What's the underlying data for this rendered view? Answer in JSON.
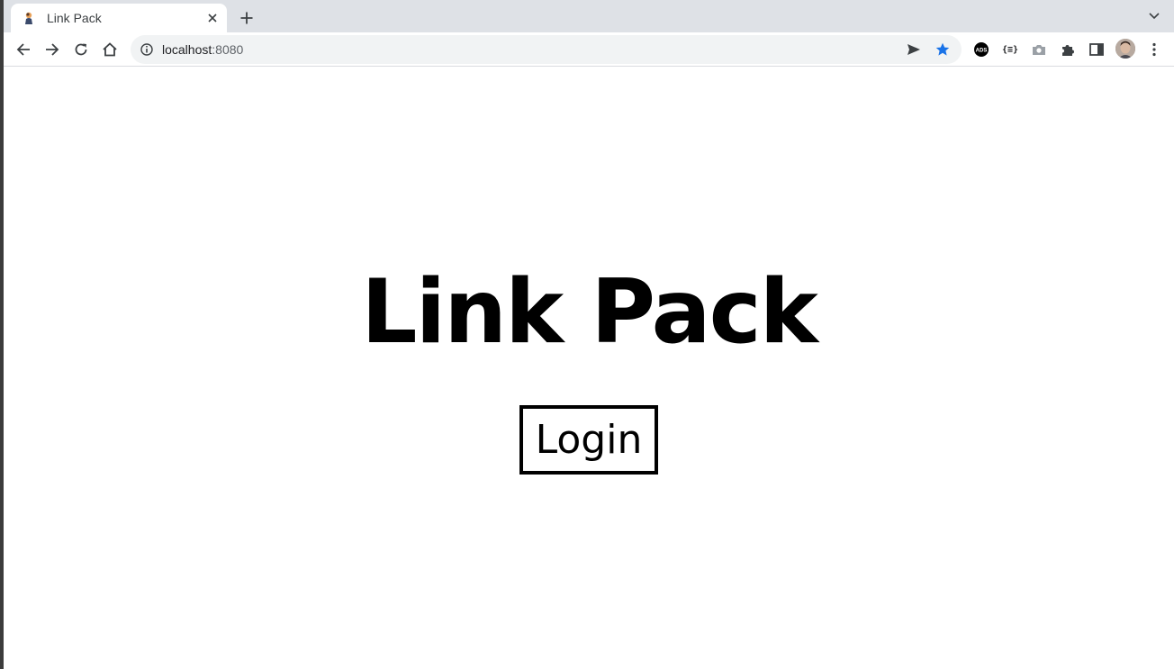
{
  "browser": {
    "tab": {
      "title": "Link Pack",
      "favicon": "app-favicon-icon",
      "close": "close-icon"
    },
    "new_tab": "plus-icon",
    "tab_search": "chevron-down-icon",
    "toolbar": {
      "back": "arrow-back-icon",
      "forward": "arrow-forward-icon",
      "reload": "reload-icon",
      "home": "home-icon"
    },
    "omnibox": {
      "host": "localhost",
      "port": ":8080",
      "info_icon": "info-icon",
      "send_icon": "send-tab-icon",
      "bookmark_icon": "star-filled-icon"
    },
    "extensions": {
      "ads_label": "ADS",
      "json_label": "{≡}"
    }
  },
  "page": {
    "title": "Link Pack",
    "login_label": "Login"
  },
  "colors": {
    "tabstrip": "#dee1e6",
    "omnibox": "#f1f3f4",
    "bookmark_star": "#1a73e8",
    "text": "#000000"
  }
}
